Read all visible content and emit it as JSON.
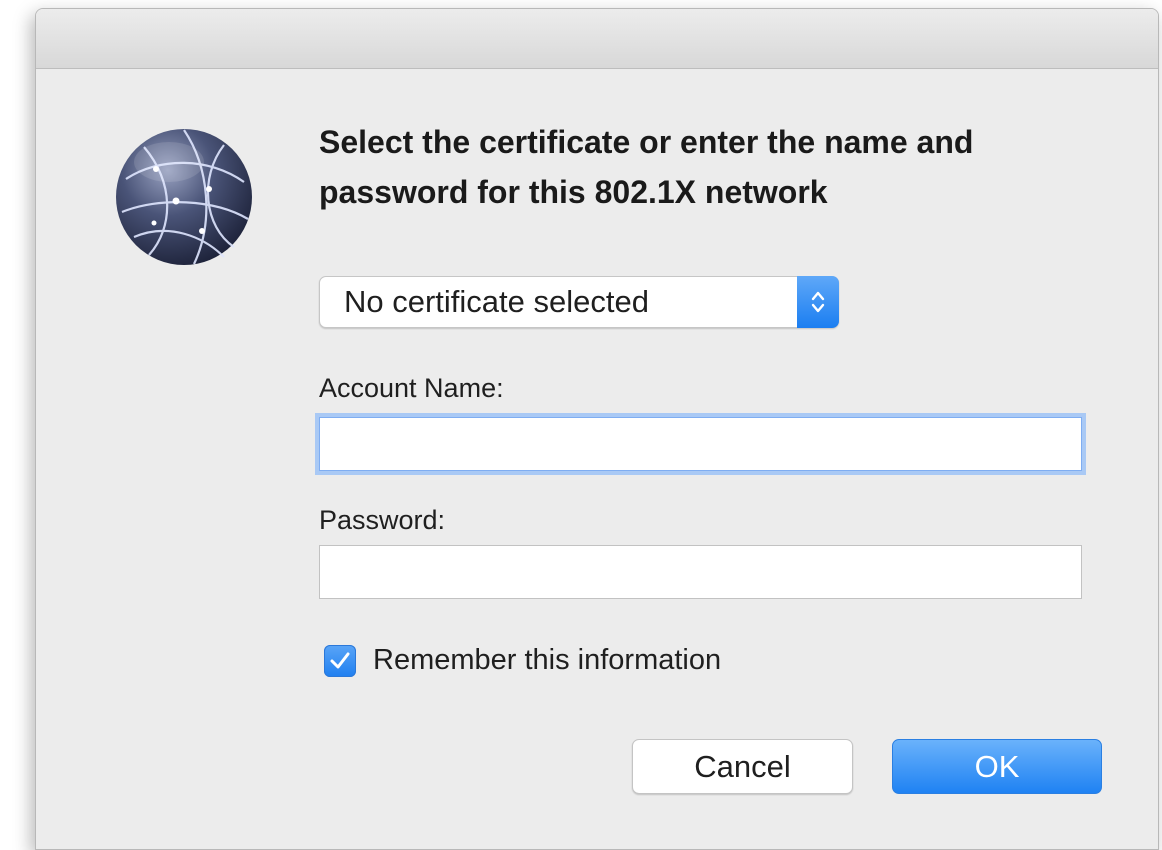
{
  "dialog": {
    "heading": "Select the certificate or enter the name and password for this 802.1X network",
    "icon": "network-globe-icon"
  },
  "certificate_popup": {
    "selected": "No certificate selected",
    "icon": "up-down-chevron-icon"
  },
  "account": {
    "label": "Account Name:",
    "value": ""
  },
  "password": {
    "label": "Password:",
    "value": ""
  },
  "remember": {
    "label": "Remember this information",
    "checked": true
  },
  "buttons": {
    "cancel": "Cancel",
    "ok": "OK"
  },
  "colors": {
    "accent": "#1b7ef1",
    "focus_ring": "#a9c9f5",
    "window_bg": "#ececec"
  }
}
